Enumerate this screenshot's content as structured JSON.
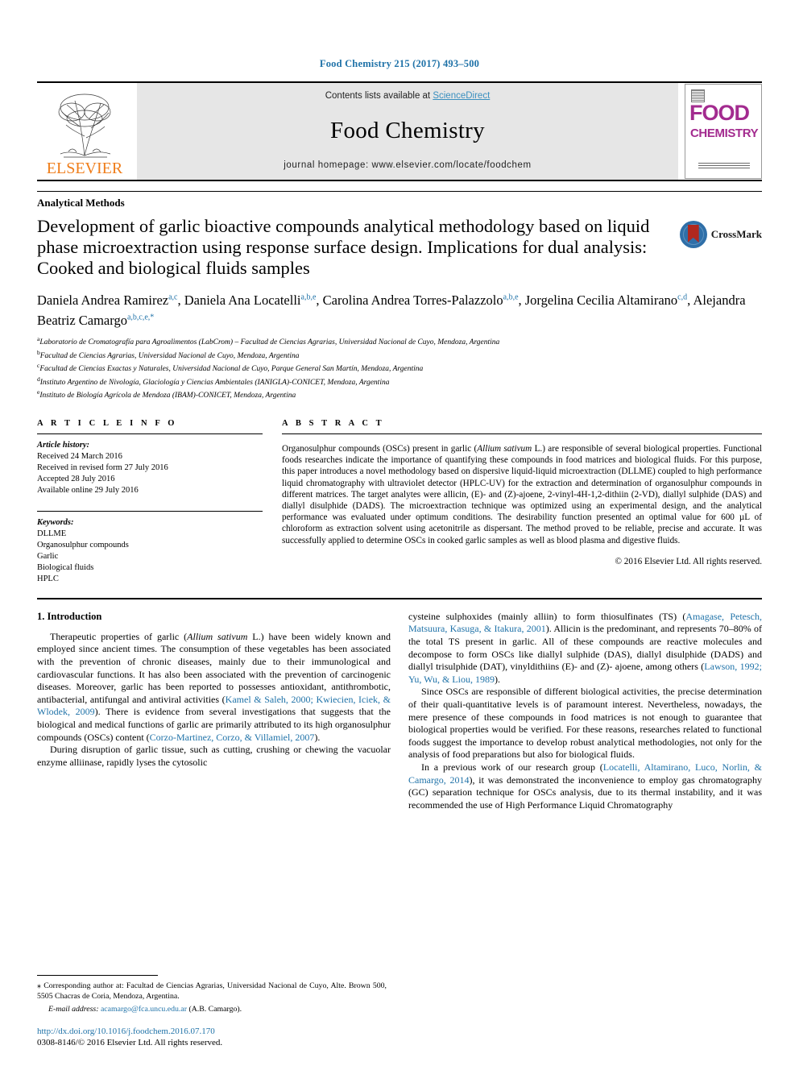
{
  "running_head": "Food Chemistry 215 (2017) 493–500",
  "masthead": {
    "contents_text": "Contents lists available at ",
    "sciencedirect": "ScienceDirect",
    "journal_title": "Food Chemistry",
    "homepage": "journal homepage: www.elsevier.com/locate/foodchem",
    "publisher": "ELSEVIER",
    "cover": {
      "line1": "FOOD",
      "line2": "CHEMISTRY"
    },
    "link_color": "#3a8fbf",
    "publisher_color": "#ef7d1a",
    "cover_color": "#a32b8f"
  },
  "section_tag": "Analytical Methods",
  "title": "Development of garlic bioactive compounds analytical methodology based on liquid phase microextraction using response surface design. Implications for dual analysis: Cooked and biological fluids samples",
  "crossmark": {
    "label": "CrossMark"
  },
  "authors": [
    {
      "name": "Daniela Andrea Ramirez",
      "sup": "a,c",
      "sep": ", "
    },
    {
      "name": "Daniela Ana Locatelli",
      "sup": "a,b,e",
      "sep": ", "
    },
    {
      "name": "Carolina Andrea Torres-Palazzolo",
      "sup": "a,b,e",
      "sep": ", "
    },
    {
      "name": "Jorgelina Cecilia Altamirano",
      "sup": "c,d",
      "sep": ", "
    },
    {
      "name": "Alejandra Beatriz Camargo",
      "sup": "a,b,c,e,*",
      "sep": ""
    }
  ],
  "affiliations": [
    {
      "marker": "a",
      "text": "Laboratorio de Cromatografía para Agroalimentos (LabCrom) – Facultad de Ciencias Agrarias, Universidad Nacional de Cuyo, Mendoza, Argentina"
    },
    {
      "marker": "b",
      "text": "Facultad de Ciencias Agrarias, Universidad Nacional de Cuyo, Mendoza, Argentina"
    },
    {
      "marker": "c",
      "text": "Facultad de Ciencias Exactas y Naturales, Universidad Nacional de Cuyo, Parque General San Martín, Mendoza, Argentina"
    },
    {
      "marker": "d",
      "text": "Instituto Argentino de Nivología, Glaciología y Ciencias Ambientales (IANIGLA)-CONICET, Mendoza, Argentina"
    },
    {
      "marker": "e",
      "text": "Instituto de Biología Agrícola de Mendoza (IBAM)-CONICET, Mendoza, Argentina"
    }
  ],
  "article_info": {
    "heading": "A R T I C L E    I N F O",
    "history_label": "Article history:",
    "history": [
      "Received 24 March 2016",
      "Received in revised form 27 July 2016",
      "Accepted 28 July 2016",
      "Available online 29 July 2016"
    ],
    "keywords_label": "Keywords:",
    "keywords": [
      "DLLME",
      "Organosulphur compounds",
      "Garlic",
      "Biological fluids",
      "HPLC"
    ]
  },
  "abstract": {
    "heading": "A B S T R A C T",
    "p1_a": "Organosulphur compounds (OSCs) present in garlic (",
    "p1_italic": "Allium sativum",
    "p1_b": " L.) are responsible of several biological properties. Functional foods researches indicate the importance of quantifying these compounds in food matrices and biological fluids. For this purpose, this paper introduces a novel methodology based on dispersive liquid-liquid microextraction (DLLME) coupled to high performance liquid chromatography with ultraviolet detector (HPLC-UV) for the extraction and determination of organosulphur compounds in different matrices. The target analytes were allicin, (E)- and (Z)-ajoene, 2-vinyl-4H-1,2-dithiin (2-VD), diallyl sulphide (DAS) and diallyl disulphide (DADS). The microextraction technique was optimized using an experimental design, and the analytical performance was evaluated under optimum conditions. The desirability function presented an optimal value for 600 µL of chloroform as extraction solvent using acetonitrile as dispersant. The method proved to be reliable, precise and accurate. It was successfully applied to determine OSCs in cooked garlic samples as well as blood plasma and digestive fluids.",
    "copyright": "© 2016 Elsevier Ltd. All rights reserved."
  },
  "body": {
    "intro_heading": "1. Introduction",
    "left": {
      "p1_a": "Therapeutic properties of garlic (",
      "p1_italic": "Allium sativum",
      "p1_b": " L.) have been widely known and employed since ancient times. The consumption of these vegetables has been associated with the prevention of chronic diseases, mainly due to their immunological and cardiovascular functions. It has also been associated with the prevention of carcinogenic diseases. Moreover, garlic has been reported to possesses antioxidant, antithrombotic, antibacterial, antifungal and antiviral activities (",
      "p1_ref1": "Kamel & Saleh, 2000; Kwiecien, Iciek, & Wlodek, 2009",
      "p1_c": "). There is evidence from several investigations that suggests that the biological and medical functions of garlic are primarily attributed to its high organosulphur compounds (OSCs) content (",
      "p1_ref2": "Corzo-Martinez, Corzo, & Villamiel, 2007",
      "p1_d": ").",
      "p2": "During disruption of garlic tissue, such as cutting, crushing or chewing the vacuolar enzyme alliinase, rapidly lyses the cytosolic"
    },
    "right": {
      "p1_a": "cysteine sulphoxides (mainly alliin) to form thiosulfinates (TS) (",
      "p1_ref1": "Amagase, Petesch, Matsuura, Kasuga, & Itakura, 2001",
      "p1_b": "). Allicin is the predominant, and represents 70–80% of the total TS present in garlic. All of these compounds are reactive molecules and decompose to form OSCs like diallyl sulphide (DAS), diallyl disulphide (DADS) and diallyl trisulphide (DAT), vinyldithiins (E)- and (Z)- ajoene, among others (",
      "p1_ref2": "Lawson, 1992; Yu, Wu, & Liou, 1989",
      "p1_c": ").",
      "p2": "Since OSCs are responsible of different biological activities, the precise determination of their quali-quantitative levels is of paramount interest. Nevertheless, nowadays, the mere presence of these compounds in food matrices is not enough to guarantee that biological properties would be verified. For these reasons, researches related to functional foods suggest the importance to develop robust analytical methodologies, not only for the analysis of food preparations but also for biological fluids.",
      "p3_a": "In a previous work of our research group (",
      "p3_ref": "Locatelli, Altamirano, Luco, Norlin, & Camargo, 2014",
      "p3_b": "), it was demonstrated the inconvenience to employ gas chromatography (GC) separation technique for OSCs analysis, due to its thermal instability, and it was recommended the use of High Performance Liquid Chromatography"
    }
  },
  "footer": {
    "corresponding": "Corresponding author at: Facultad de Ciencias Agrarias, Universidad Nacional de Cuyo, Alte. Brown 500, 5505 Chacras de Coria, Mendoza, Argentina.",
    "email_label": "E-mail address:",
    "email": "acamargo@fca.uncu.edu.ar",
    "email_owner": "(A.B. Camargo).",
    "doi": "http://dx.doi.org/10.1016/j.foodchem.2016.07.170",
    "issn": "0308-8146/© 2016 Elsevier Ltd. All rights reserved."
  }
}
